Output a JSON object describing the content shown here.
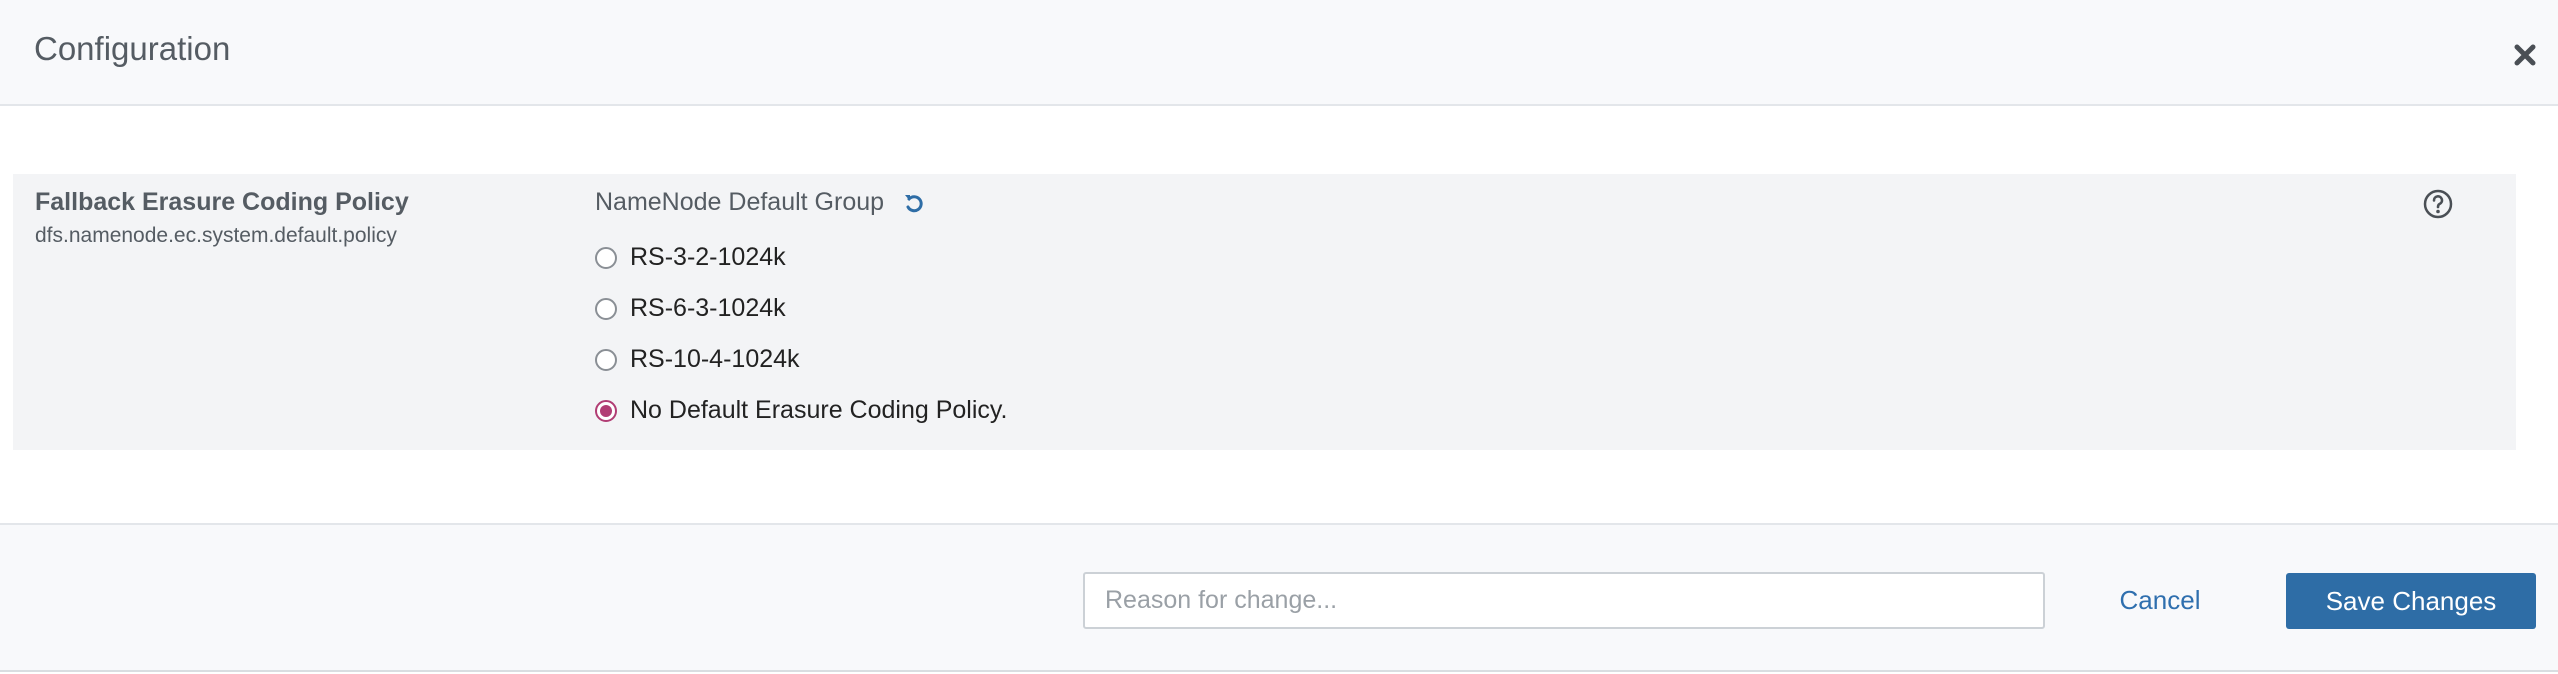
{
  "dialog": {
    "title": "Configuration",
    "close_icon": "close-icon"
  },
  "property": {
    "display_name": "Fallback Erasure Coding Policy",
    "key": "dfs.namenode.ec.system.default.policy",
    "group_label": "NameNode Default Group",
    "reset_icon": "undo-icon",
    "help_icon": "question-circle-icon",
    "options": [
      {
        "label": "RS-3-2-1024k",
        "selected": false
      },
      {
        "label": "RS-6-3-1024k",
        "selected": false
      },
      {
        "label": "RS-10-4-1024k",
        "selected": false
      },
      {
        "label": "No Default Erasure Coding Policy.",
        "selected": true
      }
    ]
  },
  "footer": {
    "reason_placeholder": "Reason for change...",
    "reason_value": "",
    "cancel_label": "Cancel",
    "save_label": "Save Changes"
  },
  "colors": {
    "accent_blue": "#2e6da6",
    "radio_selected": "#b13d74",
    "row_background": "#f3f4f6"
  }
}
